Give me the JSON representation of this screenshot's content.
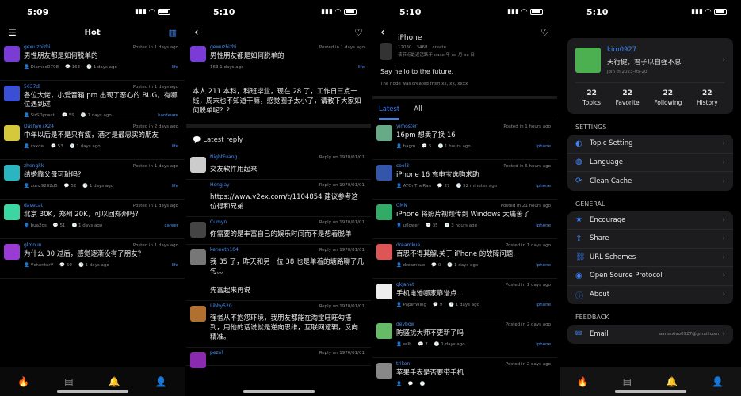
{
  "colors": {
    "accent": "#3b82f6",
    "bg": "#000000"
  },
  "status_times": [
    "5:09",
    "5:10",
    "5:10",
    "5:10"
  ],
  "hot": {
    "title": "Hot",
    "topics": [
      {
        "user": "gewuzhizhi",
        "posted": "Posted in 1 days ago",
        "title": "男性朋友都是如何脱单的",
        "last": "Diamod0708",
        "replies": "163",
        "ago": "1 days ago",
        "node": "life",
        "av": "#7a3bd6"
      },
      {
        "user": "5637dl",
        "posted": "Posted in 1 days ago",
        "title": "各位大佬，小爱音箱 pro 出现了恶心的 BUG，有哪位遇到过",
        "last": "SirSDynasti",
        "replies": "59",
        "ago": "1 days ago",
        "node": "hardware",
        "av": "#3b4fd6"
      },
      {
        "user": "Dashye7X24",
        "posted": "Posted in 2 days ago",
        "title": "中年以后是不是只有瘦，酒才是最忠实的朋友",
        "last": "cxxdw",
        "replies": "53",
        "ago": "1 days ago",
        "node": "life",
        "av": "#d6c83b"
      },
      {
        "user": "zhengkk",
        "posted": "Posted in 1 days ago",
        "title": "结婚靠父母可耻吗？",
        "last": "xunz9202d5",
        "replies": "52",
        "ago": "1 days ago",
        "node": "life",
        "av": "#2ab6c0"
      },
      {
        "user": "davecat",
        "posted": "Posted in 1 days ago",
        "title": "北京 30K，郑州 20K，可以回郑州吗？",
        "last": "bua2ds",
        "replies": "51",
        "ago": "1 days ago",
        "node": "career",
        "av": "#3bd6a2"
      },
      {
        "user": "glmoun",
        "posted": "Posted in 1 days ago",
        "title": "为什么 30 过后，感觉逐渐没有了朋友？",
        "last": "VchenterV",
        "replies": "50",
        "ago": "1 days ago",
        "node": "life",
        "av": "#9b3bd6"
      }
    ]
  },
  "detail": {
    "user": "gewuzhizhi",
    "posted": "Posted in 1 days ago",
    "title": "男性朋友都是如何脱单的",
    "meta": "163  1 days ago",
    "node": "life",
    "content": "本人 211 本科，科班毕业，现在 28 了，工作日三点一线，周末也不知道干嘛，感觉圈子太小了，请教下大家如何脱单呢？？",
    "latest_reply": "Latest reply",
    "replies": [
      {
        "name": "NightFuang",
        "time": "Reply on 1970/01/01",
        "text": "交友软件用起来",
        "av": "#ccc"
      },
      {
        "name": "Hongjay",
        "time": "Reply on 1970/01/01",
        "text": "https://www.v2ex.com/t/1104854 建议参考这位得和兄弟",
        "av": "#000"
      },
      {
        "name": "Cumyn",
        "time": "Reply on 1970/01/01",
        "text": "你需要的是丰富自己的娱乐时间而不是想着脱单",
        "av": "#444"
      },
      {
        "name": "kenneth104",
        "time": "Reply on 1970/01/01",
        "text": "我 35 了，昨天和另一位 38 也是单着的塘路聊了几句。。\n\n先富起来再说",
        "av": "#777"
      },
      {
        "name": "Libby520",
        "time": "Reply on 1970/01/01",
        "text": "强者从不抱怨环境，我朋友都能在淘宝旺旺勾搭到，用他的话说就是逆向思维，互联网逻辑，反向精准。",
        "av": "#b07030"
      },
      {
        "name": "pezol",
        "time": "Reply on 1970/01/01",
        "text": "",
        "av": "#8a2ab0"
      }
    ]
  },
  "node": {
    "name": "iPhone",
    "topics_count": "12030",
    "stars": "3468",
    "create": "create",
    "sub": "该节点最近活跃于 xxxx 年 xx 月 xx 日",
    "slogan": "Say hello to the future.",
    "created": "The node was created from xx, xx, xxxx",
    "tab_latest": "Latest",
    "tab_all": "All",
    "topics": [
      {
        "user": "yimoster",
        "posted": "Posted in 1 hours ago",
        "title": "16pm 想卖了换 16",
        "last": "hagm",
        "replies": "5",
        "ago": "1 hours ago",
        "node": "iphone",
        "av": "#6a8"
      },
      {
        "user": "cool3",
        "posted": "Posted in 6 hours ago",
        "title": "iPhone 16 充电宝选购求助",
        "last": "ATOnTheRan",
        "replies": "27",
        "ago": "52 minutes ago",
        "node": "iphone",
        "av": "#35a"
      },
      {
        "user": "CMN",
        "posted": "Posted in 21 hours ago",
        "title": "iPhone 将照片视频传到 Windows 太痛苦了",
        "last": "uflower",
        "replies": "35",
        "ago": "3 hours ago",
        "node": "iphone",
        "av": "#3a6"
      },
      {
        "user": "dreamkue",
        "posted": "Posted in 1 days ago",
        "title": "百思不得其解,关于 iPhone 的故障问题,",
        "last": "dreamkue",
        "replies": "0",
        "ago": "1 days ago",
        "node": "iphone",
        "av": "#d55"
      },
      {
        "user": "gkjanet",
        "posted": "Posted in 1 days ago",
        "title": "手机电池哪家靠谱点...",
        "last": "PaperWing",
        "replies": "9",
        "ago": "1 days ago",
        "node": "iphone",
        "av": "#eee"
      },
      {
        "user": "devbow",
        "posted": "Posted in 2 days ago",
        "title": "防骚扰大师不更新了吗",
        "last": "wllh",
        "replies": "7",
        "ago": "1 days ago",
        "node": "iphone",
        "av": "#6b6"
      },
      {
        "user": "trikon",
        "posted": "Posted in 2 days ago",
        "title": "苹果手表是否要带手机",
        "last": "",
        "replies": "",
        "ago": "",
        "node": "",
        "av": "#888"
      }
    ]
  },
  "profile": {
    "username": "kim0927",
    "motto": "天行健，君子以自强不息",
    "joined": "Join in 2023-05-20",
    "stats": [
      {
        "n": "22",
        "l": "Topics"
      },
      {
        "n": "22",
        "l": "Favorite"
      },
      {
        "n": "22",
        "l": "Following"
      },
      {
        "n": "22",
        "l": "History"
      }
    ],
    "settings_title": "SETTINGS",
    "settings": [
      {
        "icon": "palette-icon",
        "glyph": "◐",
        "label": "Topic Setting"
      },
      {
        "icon": "globe-icon",
        "glyph": "◍",
        "label": "Language"
      },
      {
        "icon": "refresh-icon",
        "glyph": "⟳",
        "label": "Clean Cache"
      }
    ],
    "general_title": "GENERAL",
    "general": [
      {
        "icon": "star-icon",
        "glyph": "★",
        "label": "Encourage"
      },
      {
        "icon": "share-icon",
        "glyph": "⇪",
        "label": "Share"
      },
      {
        "icon": "link-icon",
        "glyph": "⛓",
        "label": "URL Schemes"
      },
      {
        "icon": "github-icon",
        "glyph": "◉",
        "label": "Open Source Protocol"
      },
      {
        "icon": "info-icon",
        "glyph": "ⓘ",
        "label": "About"
      }
    ],
    "feedback_title": "FEEDBACK",
    "email_label": "Email",
    "email_value": "aaronxiao0927@gmail.com"
  }
}
